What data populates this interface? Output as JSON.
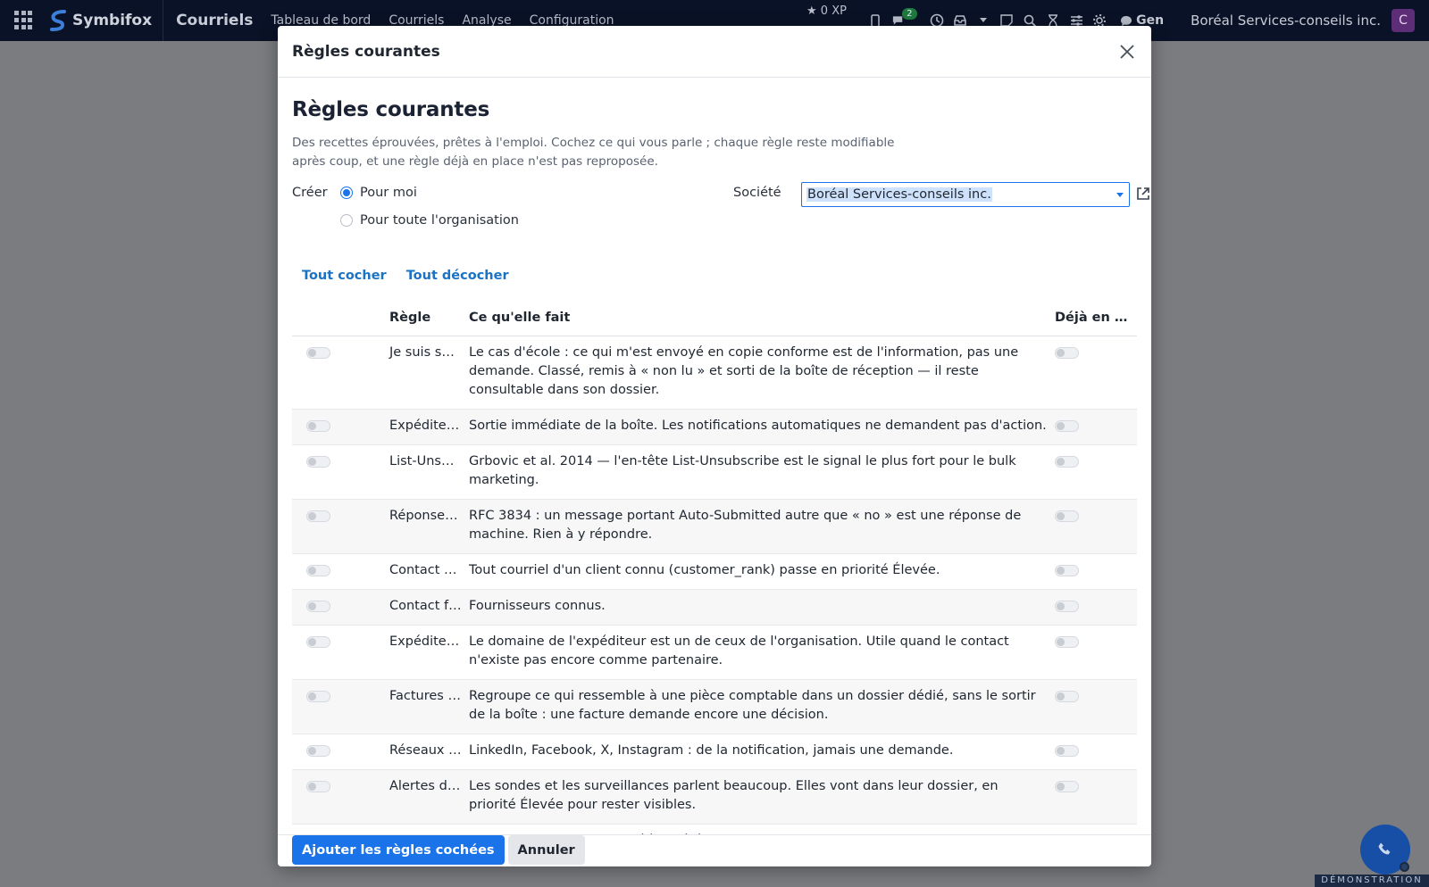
{
  "navbar": {
    "brand": "Symbifox",
    "app_title": "Courriels",
    "menu": [
      "Tableau de bord",
      "Courriels",
      "Analyse",
      "Configuration"
    ],
    "xp": "0 XP",
    "chat_count": "2",
    "gen_label": "Gen",
    "company": "Boréal Services-conseils inc.",
    "avatar_initial": "C",
    "icons": [
      "apps-icon",
      "phone-icon",
      "chat-icon",
      "clock-icon",
      "inbox-icon",
      "caret-icon",
      "note-icon",
      "search-icon",
      "hourglass-icon",
      "sliders-icon",
      "gear-icon",
      "ai-chat-icon"
    ]
  },
  "modal": {
    "header_title": "Règles courantes",
    "page_title": "Règles courantes",
    "intro": "Des recettes éprouvées, prêtes à l'emploi. Cochez ce qui vous parle ; chaque règle reste modifiable après coup, et une règle déjà en place n'est pas reproposée.",
    "create_label": "Créer",
    "radio_me": "Pour moi",
    "radio_org": "Pour toute l'organisation",
    "company_label": "Société",
    "company_value": "Boréal Services-conseils inc.",
    "check_all": "Tout cocher",
    "uncheck_all": "Tout décocher",
    "columns": {
      "rule": "Règle",
      "does": "Ce qu'elle fait",
      "already": "Déjà en p…"
    },
    "rows": [
      {
        "name": "Je suis se…",
        "desc": "Le cas d'école : ce qui m'est envoyé en copie conforme est de l'information, pas une demande. Classé, remis à « non lu » et sorti de la boîte de réception — il reste consultable dans son dossier."
      },
      {
        "name": "Expéditeu…",
        "desc": "Sortie immédiate de la boîte. Les notifications automatiques ne demandent pas d'action."
      },
      {
        "name": "List-Unsu…",
        "desc": "Grbovic et al. 2014 — l'en-tête List-Unsubscribe est le signal le plus fort pour le bulk marketing."
      },
      {
        "name": "Réponses …",
        "desc": "RFC 3834 : un message portant Auto-Submitted autre que « no » est une réponse de machine. Rien à y répondre."
      },
      {
        "name": "Contact cl…",
        "desc": "Tout courriel d'un client connu (customer_rank) passe en priorité Élevée."
      },
      {
        "name": "Contact f…",
        "desc": "Fournisseurs connus."
      },
      {
        "name": "Expéditeu…",
        "desc": "Le domaine de l'expéditeur est un de ceux de l'organisation. Utile quand le contact n'existe pas encore comme partenaire."
      },
      {
        "name": "Factures e…",
        "desc": "Regroupe ce qui ressemble à une pièce comptable dans un dossier dédié, sans le sortir de la boîte : une facture demande encore une décision."
      },
      {
        "name": "Réseaux s…",
        "desc": "LinkedIn, Facebook, X, Instagram : de la notification, jamais une demande."
      },
      {
        "name": "Alertes de…",
        "desc": "Les sondes et les surveillances parlent beaucoup. Elles vont dans leur dossier, en priorité Élevée pour rester visibles."
      },
      {
        "name": "Invitation…",
        "desc": "Les invitations iMIP sont déjà ingérées dans l'agenda par le module. La copie courriel n'a plus"
      }
    ],
    "add_button": "Ajouter les règles cochées",
    "cancel_button": "Annuler"
  },
  "demo_ribbon": "DÉMONSTRATION",
  "colors": {
    "navbar_bg": "#0a1227",
    "accent": "#1a73e8",
    "link": "#1a73c4",
    "avatar": "#5e2d78",
    "fab": "#174ea6"
  }
}
